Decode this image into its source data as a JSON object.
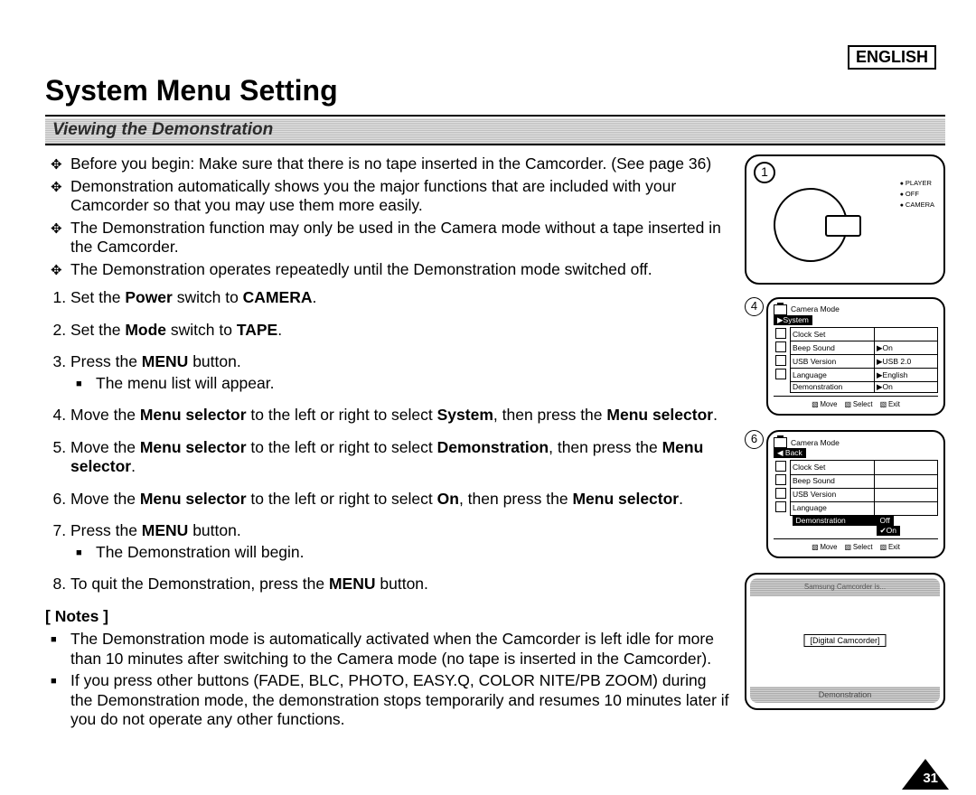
{
  "lang": "ENGLISH",
  "title": "System Menu Setting",
  "section_title": "Viewing the Demonstration",
  "intro": [
    "Before you begin: Make sure that there is no tape inserted in the Camcorder. (See page 36)",
    "Demonstration automatically shows you the major functions that are included with your Camcorder so that you may use them more easily.",
    "The Demonstration function may only be used in the Camera mode without a tape inserted in the Camcorder.",
    "The Demonstration operates repeatedly until the Demonstration mode switched off."
  ],
  "steps": {
    "s1a": "Set the ",
    "s1b": "Power",
    "s1c": " switch to ",
    "s1d": "CAMERA",
    "s1e": ".",
    "s2a": "Set the ",
    "s2b": "Mode",
    "s2c": " switch to ",
    "s2d": "TAPE",
    "s2e": ".",
    "s3a": "Press the ",
    "s3b": "MENU",
    "s3c": " button.",
    "s3sub": "The menu list will appear.",
    "s4a": "Move the ",
    "s4b": "Menu selector",
    "s4c": " to the left or right to select ",
    "s4d": "System",
    "s4e": ", then press the ",
    "s4f": "Menu selector",
    "s4g": ".",
    "s5a": "Move the ",
    "s5b": "Menu selector",
    "s5c": " to the left or right to select ",
    "s5d": "Demonstration",
    "s5e": ", then press the ",
    "s5f": "Menu selector",
    "s5g": ".",
    "s6a": "Move the ",
    "s6b": "Menu selector",
    "s6c": " to the left or right to select ",
    "s6d": "On",
    "s6e": ", then press the ",
    "s6f": "Menu selector",
    "s6g": ".",
    "s7a": "Press the ",
    "s7b": "MENU",
    "s7c": " button.",
    "s7sub": "The Demonstration will begin.",
    "s8a": "To quit the Demonstration, press the ",
    "s8b": "MENU",
    "s8c": " button."
  },
  "notes_head": "[ Notes ]",
  "notes": [
    "The Demonstration mode is automatically activated when the Camcorder is left idle for more than 10 minutes after switching to the Camera mode (no tape is inserted in the Camcorder).",
    "If you press other buttons (FADE, BLC, PHOTO, EASY.Q, COLOR NITE/PB ZOOM) during the Demonstration mode, the demonstration stops temporarily and resumes 10 minutes later if you do not operate any other functions."
  ],
  "fig1": {
    "num": "1",
    "labels": [
      "PLAYER",
      "OFF",
      "CAMERA"
    ]
  },
  "fig4": {
    "num": "4",
    "mode": "Camera Mode",
    "highlight": "▶System",
    "rows": [
      {
        "name": "Clock Set",
        "val": ""
      },
      {
        "name": "Beep Sound",
        "val": "▶On"
      },
      {
        "name": "USB Version",
        "val": "▶USB 2.0"
      },
      {
        "name": "Language",
        "val": "▶English"
      },
      {
        "name": "Demonstration",
        "val": "▶On"
      }
    ],
    "footer": [
      "Move",
      "Select",
      "Exit"
    ]
  },
  "fig6": {
    "num": "6",
    "mode": "Camera Mode",
    "back": "◀ Back",
    "rows": [
      {
        "name": "Clock Set",
        "val": ""
      },
      {
        "name": "Beep Sound",
        "val": ""
      },
      {
        "name": "USB Version",
        "val": ""
      },
      {
        "name": "Language",
        "val": ""
      }
    ],
    "demo_row": "Demonstration",
    "demo_off": "Off",
    "demo_on": "✔On",
    "footer": [
      "Move",
      "Select",
      "Exit"
    ]
  },
  "fig_demo": {
    "top": "Samsung Camcorder is...",
    "badge": "[Digital Camcorder]",
    "bottom": "Demonstration"
  },
  "page_number": "31"
}
